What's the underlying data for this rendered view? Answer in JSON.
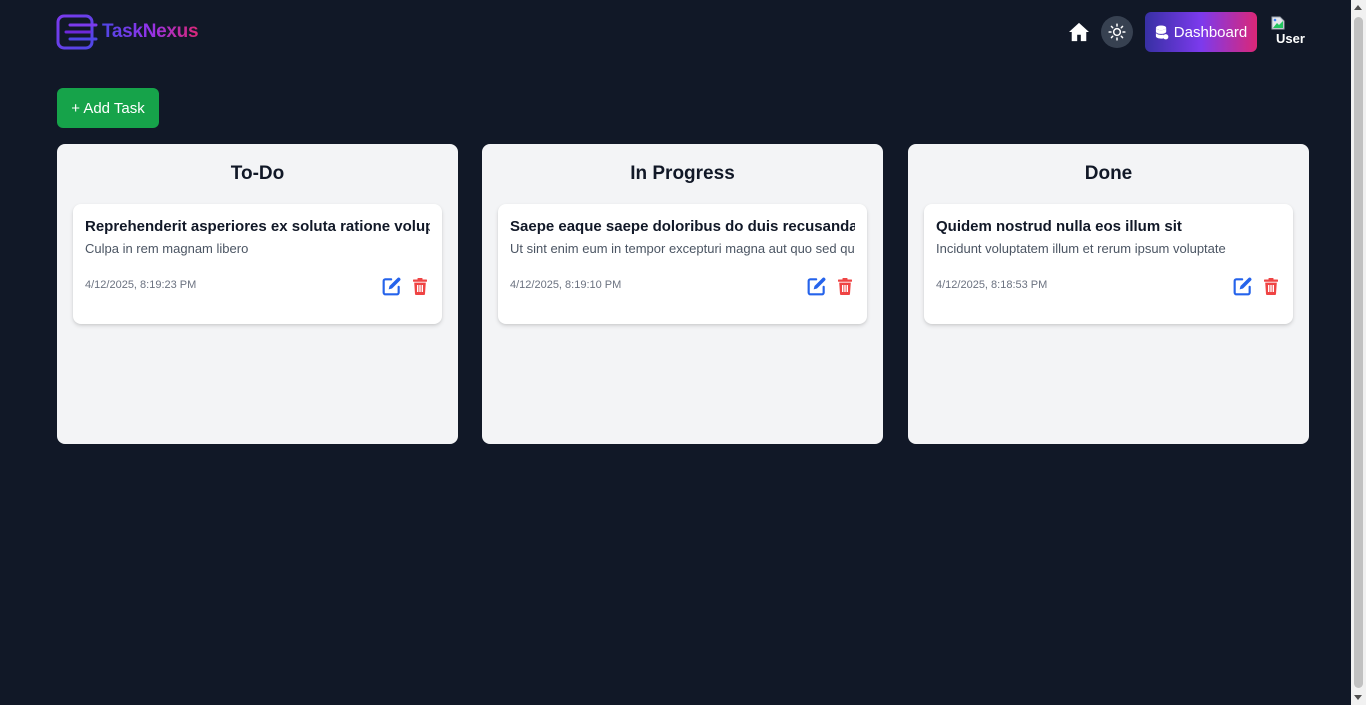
{
  "app": {
    "name": "TaskNexus"
  },
  "header": {
    "dashboard_label": "Dashboard",
    "user_label": "User"
  },
  "toolbar": {
    "add_task_label": "+ Add Task"
  },
  "columns": [
    {
      "title": "To-Do",
      "tasks": [
        {
          "title": "Reprehenderit asperiores ex soluta ratione volupta",
          "description": "Culpa in rem magnam libero",
          "timestamp": "4/12/2025, 8:19:23 PM"
        }
      ]
    },
    {
      "title": "In Progress",
      "tasks": [
        {
          "title": "Saepe eaque saepe doloribus do duis recusandae It",
          "description": "Ut sint enim eum in tempor excepturi magna aut quo sed quo",
          "timestamp": "4/12/2025, 8:19:10 PM"
        }
      ]
    },
    {
      "title": "Done",
      "tasks": [
        {
          "title": "Quidem nostrud nulla eos illum sit",
          "description": "Incidunt voluptatem illum et rerum ipsum voluptate",
          "timestamp": "4/12/2025, 8:18:53 PM"
        }
      ]
    }
  ],
  "colors": {
    "background": "#111827",
    "column_bg": "#f3f4f6",
    "add_button": "#16a34a",
    "edit_icon": "#2563eb",
    "delete_icon": "#ef4444"
  },
  "icons": {
    "logo": "logo-icon",
    "home": "home-icon",
    "theme": "sun-icon",
    "dashboard": "database-icon",
    "avatar": "broken-image-icon",
    "edit": "edit-icon",
    "delete": "trash-icon"
  }
}
